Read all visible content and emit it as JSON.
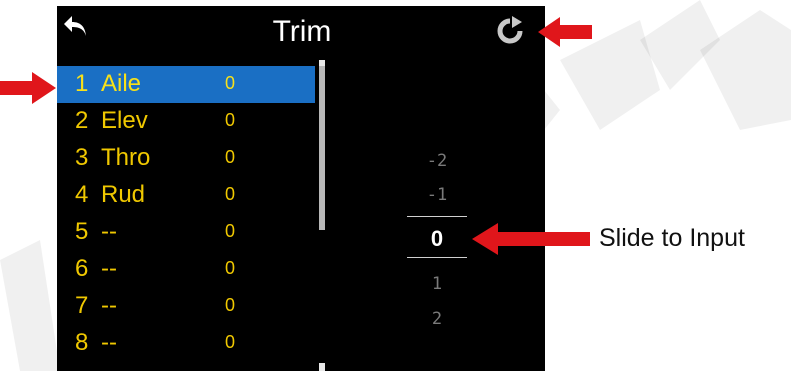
{
  "header": {
    "title": "Trim",
    "back_icon": "back-arrow-icon",
    "reset_icon": "reset-icon"
  },
  "channels": [
    {
      "num": "1",
      "name": "Aile",
      "value": "0",
      "selected": true
    },
    {
      "num": "2",
      "name": "Elev",
      "value": "0",
      "selected": false
    },
    {
      "num": "3",
      "name": "Thro",
      "value": "0",
      "selected": false
    },
    {
      "num": "4",
      "name": "Rud",
      "value": "0",
      "selected": false
    },
    {
      "num": "5",
      "name": "--",
      "value": "0",
      "selected": false
    },
    {
      "num": "6",
      "name": "--",
      "value": "0",
      "selected": false
    },
    {
      "num": "7",
      "name": "--",
      "value": "0",
      "selected": false
    },
    {
      "num": "8",
      "name": "--",
      "value": "0",
      "selected": false
    }
  ],
  "picker": {
    "values": [
      "-2",
      "-1",
      "0",
      "1",
      "2"
    ],
    "current": "0"
  },
  "annotation": {
    "callout": "Slide to Input"
  },
  "colors": {
    "screen_bg": "#000000",
    "selection": "#1a6fc4",
    "channel_text": "#f0c800",
    "arrow_red": "#e0161b"
  }
}
